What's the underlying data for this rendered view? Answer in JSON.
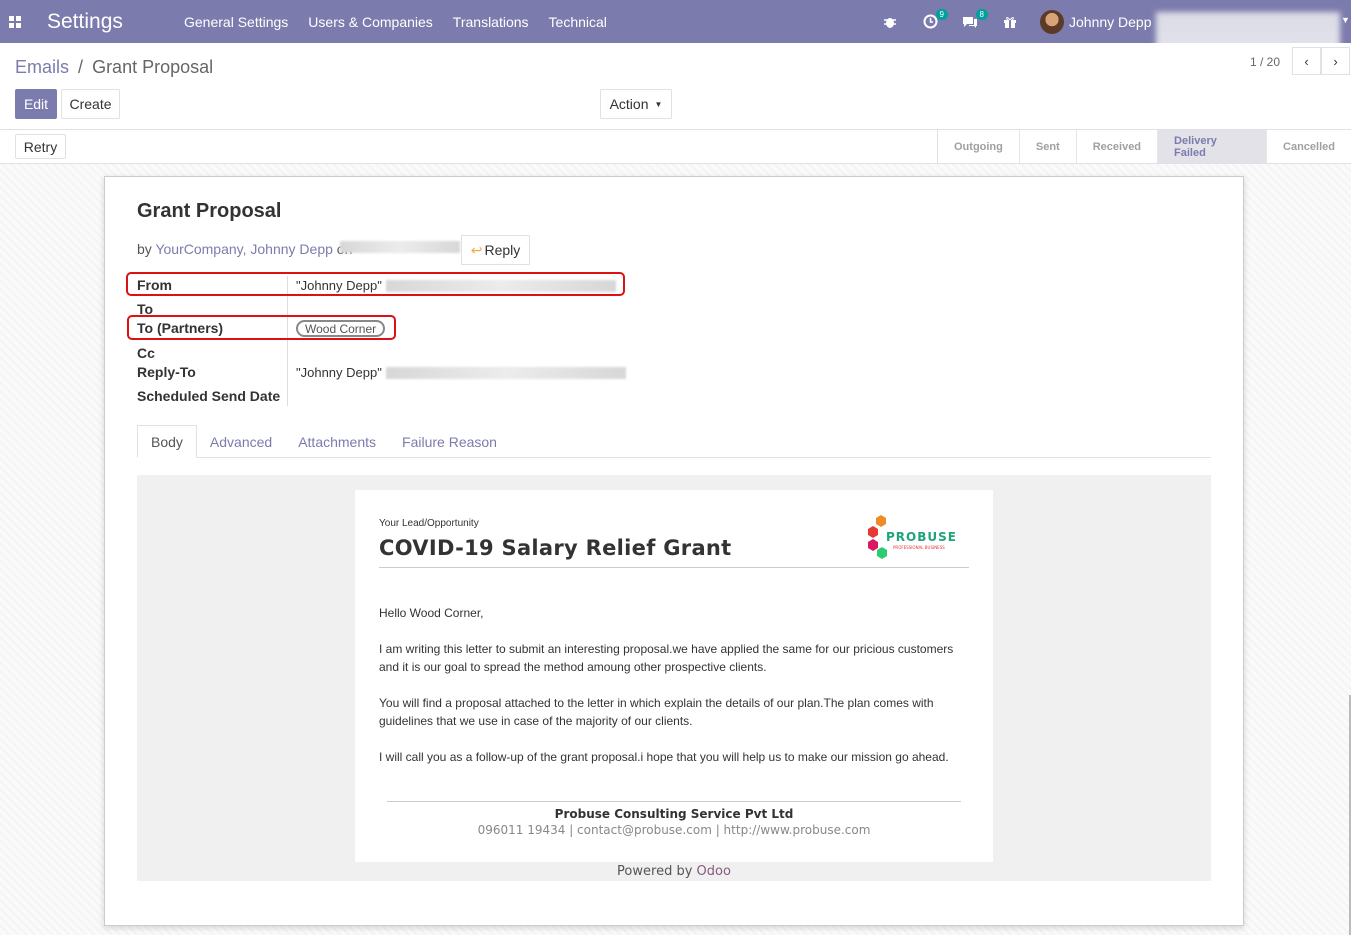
{
  "navbar": {
    "brand": "Settings",
    "menu": [
      "General Settings",
      "Users & Companies",
      "Translations",
      "Technical"
    ],
    "activity_count": "9",
    "message_count": "8",
    "user_name": "Johnny Depp"
  },
  "breadcrumb": {
    "parent": "Emails",
    "separator": "/",
    "current": "Grant Proposal"
  },
  "toolbar": {
    "edit": "Edit",
    "create": "Create",
    "action": "Action",
    "pager": "1 / 20"
  },
  "statusbar": {
    "retry": "Retry",
    "stages": [
      "Outgoing",
      "Sent",
      "Received",
      "Delivery Failed",
      "Cancelled"
    ],
    "active_stage": "Delivery Failed"
  },
  "message": {
    "subject": "Grant Proposal",
    "by": "by",
    "author": "YourCompany, Johnny Depp",
    "on": "on",
    "reply": "Reply"
  },
  "fields": {
    "from_label": "From",
    "from_value": "\"Johnny Depp\"",
    "to_label": "To",
    "to_partners_label": "To (Partners)",
    "to_partners_tag": "Wood Corner",
    "cc_label": "Cc",
    "reply_to_label": "Reply-To",
    "reply_to_value": "\"Johnny Depp\"",
    "scheduled_label": "Scheduled Send Date"
  },
  "tabs": [
    "Body",
    "Advanced",
    "Attachments",
    "Failure Reason"
  ],
  "mail": {
    "subtitle": "Your Lead/Opportunity",
    "title": "COVID-19 Salary Relief Grant",
    "logo_text": "PROBUSE",
    "logo_sub": "PROFESSIONAL BUSINESS",
    "greeting": "Hello Wood Corner,",
    "p1": "I am writing this letter to submit an interesting proposal.we have applied the same for our pricious customers and it is our goal to spread the method amoung other prospective clients.",
    "p2": "You will find a proposal attached to the letter in which explain the details of our plan.The plan comes with guidelines that we use in case of the majority of our clients.",
    "p3": "I will call you as a follow-up of the grant proposal.i hope that you will help us to make our mission go ahead.",
    "company": "Probuse Consulting Service Pvt Ltd",
    "contact": "096011 19434 | contact@probuse.com | http://www.probuse.com",
    "powered_by": "Powered by",
    "odoo": "Odoo"
  }
}
